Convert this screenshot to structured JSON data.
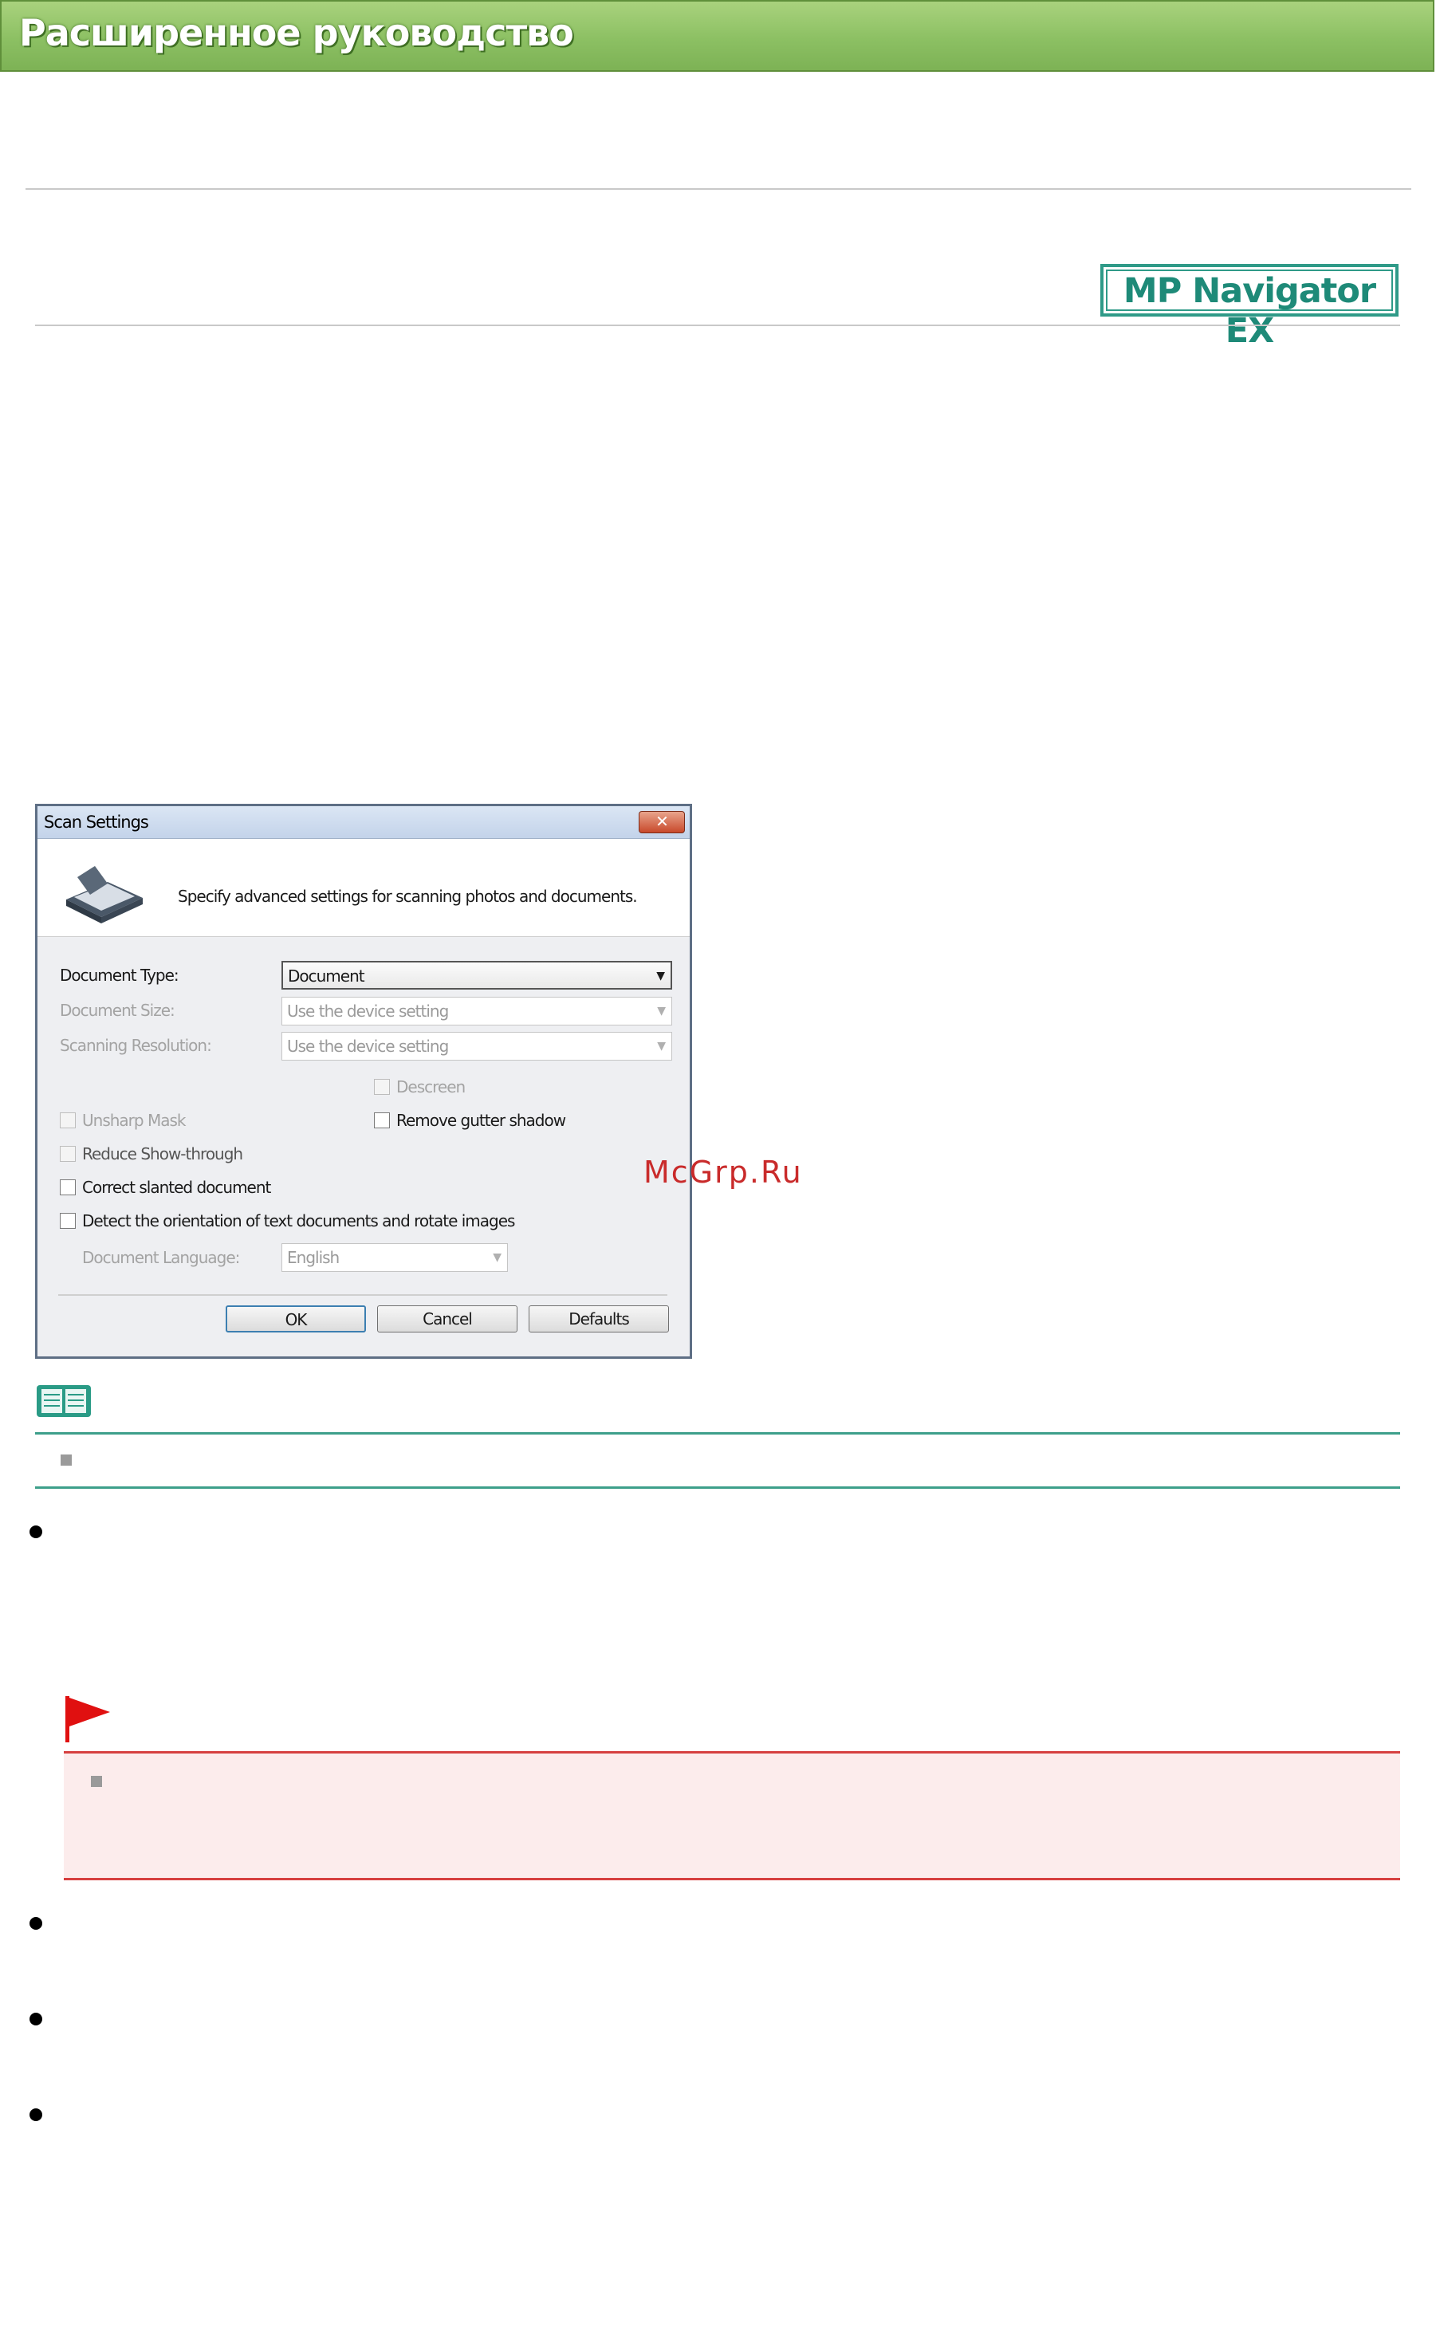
{
  "header": {
    "title": "Расширенное руководство"
  },
  "badge": {
    "text": "MP Navigator EX"
  },
  "dialog": {
    "title": "Scan Settings",
    "close_glyph": "✕",
    "description": "Specify advanced settings for scanning photos and documents.",
    "document_type_label": "Document Type:",
    "document_type_value": "Document",
    "document_size_label": "Document Size:",
    "document_size_value": "Use the device setting",
    "scanning_resolution_label": "Scanning Resolution:",
    "scanning_resolution_value": "Use the device setting",
    "descreen_label": "Descreen",
    "unsharp_mask_label": "Unsharp Mask",
    "remove_gutter_shadow_label": "Remove gutter shadow",
    "reduce_show_through_label": "Reduce Show-through",
    "correct_slanted_label": "Correct slanted document",
    "detect_orientation_label": "Detect the orientation of text documents and rotate images",
    "document_language_label": "Document Language:",
    "document_language_value": "English",
    "ok_label": "OK",
    "cancel_label": "Cancel",
    "defaults_label": "Defaults"
  },
  "watermark": {
    "text": "McGrp.Ru"
  },
  "colors": {
    "header_green": "#8cc063",
    "accent_teal": "#3d9f8b",
    "important_red": "#d64040",
    "important_bg": "#fcecec"
  },
  "icons": [
    "scanner-icon",
    "note-book-icon",
    "flag-icon",
    "close-icon",
    "dropdown-arrow-icon"
  ]
}
